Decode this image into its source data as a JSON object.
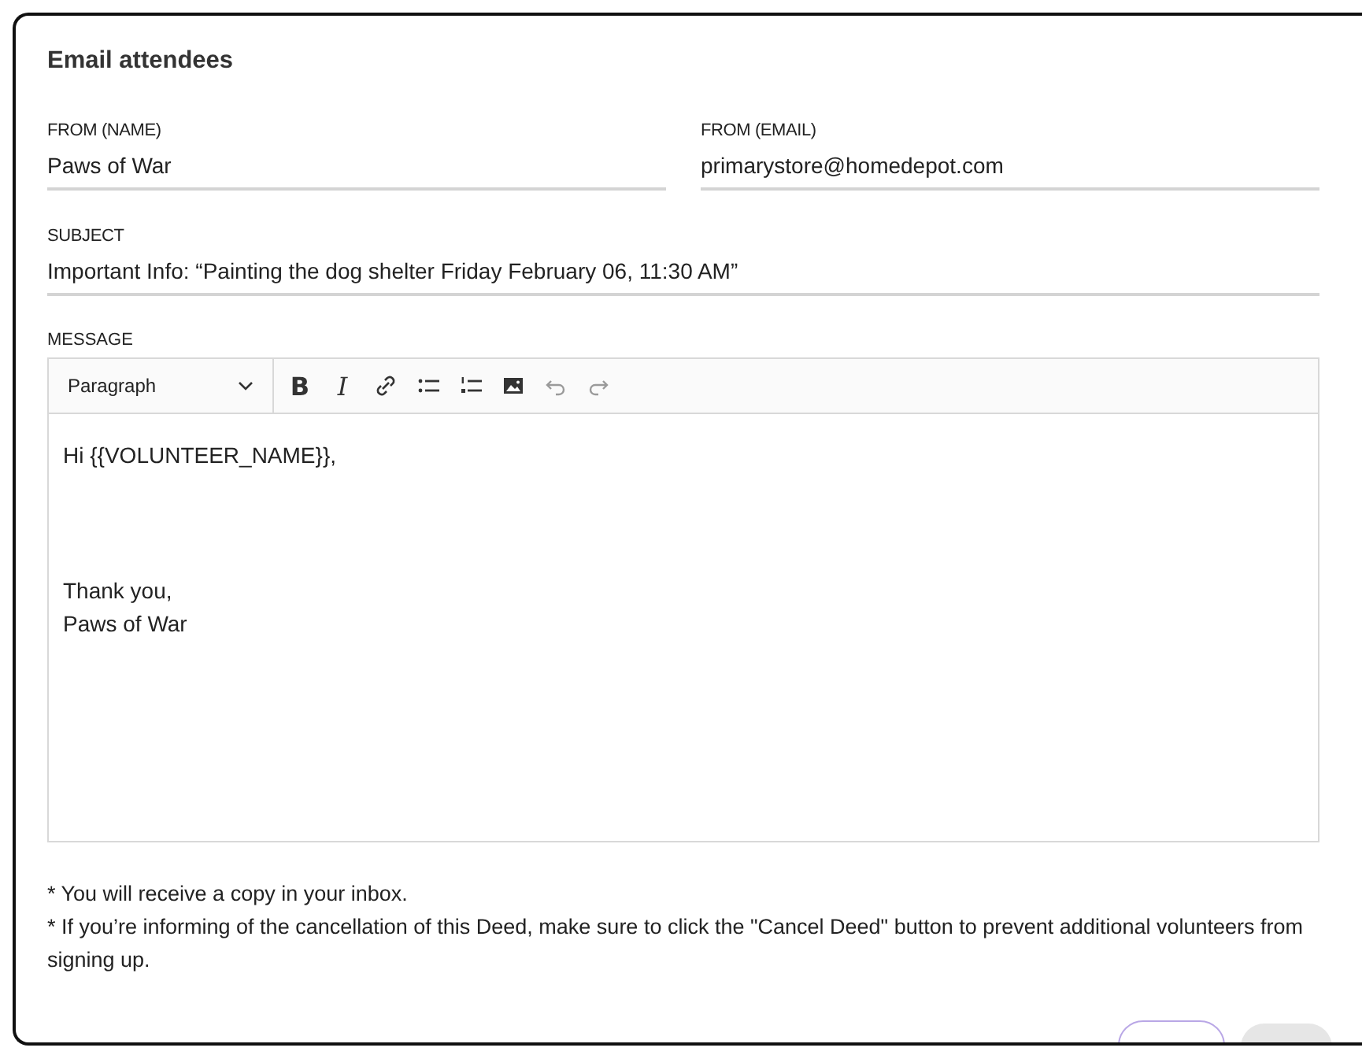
{
  "dialog": {
    "title": "Email attendees"
  },
  "fields": [
    {
      "label": "FROM (NAME)",
      "value": "Paws of War"
    },
    {
      "label": "FROM (EMAIL)",
      "value": "primarystore@homedepot.com"
    },
    {
      "label": "SUBJECT",
      "value": "Important Info: “Painting the dog shelter Friday February 06, 11:30 AM”"
    }
  ],
  "message": {
    "label": "MESSAGE",
    "block_format": "Paragraph",
    "tools": [
      {
        "kind": "bold",
        "glyph": "B",
        "disabled": false
      },
      {
        "kind": "italic",
        "glyph": "I",
        "disabled": false
      },
      {
        "kind": "link",
        "disabled": false
      },
      {
        "kind": "bullet-list",
        "disabled": false
      },
      {
        "kind": "numbered-list",
        "disabled": false
      },
      {
        "kind": "image",
        "disabled": false
      },
      {
        "kind": "undo",
        "disabled": true
      },
      {
        "kind": "redo",
        "disabled": true
      }
    ],
    "greeting": "Hi {{VOLUNTEER_NAME}},",
    "signoff": [
      "Thank you,",
      "Paws of War"
    ]
  },
  "notes": [
    "* You will receive a copy in your inbox.",
    "* If you’re informing of the cancellation of this Deed, make sure to click the \"Cancel Deed\" button to prevent additional volunteers from signing up."
  ]
}
